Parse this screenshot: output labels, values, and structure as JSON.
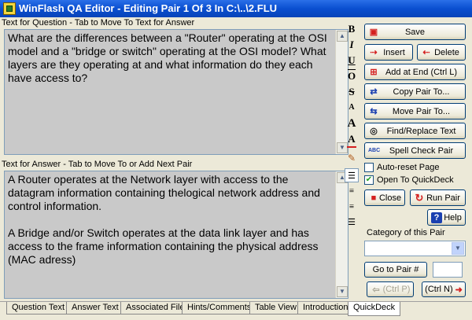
{
  "window": {
    "title": "WinFlash QA Editor - Editing Pair 1 Of 3 In C:\\..\\2.FLU"
  },
  "question": {
    "label": "Text for Question - Tab to Move To Text for Answer",
    "text": "What are the differences between a \"Router\" operating at the OSI model and a \"bridge or switch\" operating at the OSI model? What layers are they operating at and what information do they each have access to?"
  },
  "answer": {
    "label": "Text for Answer - Tab to Move To or Add Next Pair",
    "text": "A Router operates at the Network layer with access to the datagram information containing thelogical network address and control information.\n\nA Bridge and/or Switch operates at the data link layer and has access to the frame information containing the physical address (MAC adress)"
  },
  "format_toolbar": {
    "bold": "B",
    "italic": "I",
    "underline": "U",
    "overline": "O",
    "strike": "S",
    "font_size": "A",
    "font_size_big": "A",
    "font_color": "A"
  },
  "buttons": {
    "save": "Save",
    "insert": "Insert",
    "delete": "Delete",
    "add_at_end": "Add at End (Ctrl L)",
    "copy_pair": "Copy Pair To...",
    "move_pair": "Move Pair To...",
    "find_replace": "Find/Replace Text",
    "spell_check": "Spell Check Pair",
    "close": "Close",
    "run_pair": "Run Pair",
    "help": "Help",
    "go_to_pair": "Go to Pair #",
    "prev": "(Ctrl P)",
    "next": "(Ctrl N)"
  },
  "options": {
    "auto_reset": {
      "label": "Auto-reset Page",
      "checked": false
    },
    "open_quickdeck": {
      "label": "Open To QuickDeck",
      "checked": true
    }
  },
  "category": {
    "label": "Category of this Pair",
    "value": ""
  },
  "goto_value": "",
  "tabs": [
    {
      "label": "Question Text",
      "active": false
    },
    {
      "label": "Answer Text",
      "active": false
    },
    {
      "label": "Associated Files",
      "active": false
    },
    {
      "label": "Hints/Comments",
      "active": false
    },
    {
      "label": "Table View",
      "active": false
    },
    {
      "label": "Introduction",
      "active": false
    },
    {
      "label": "QuickDeck",
      "active": true
    }
  ],
  "colors": {
    "titlebar": "#0a4fd0",
    "textbox_bg": "#c9c9c9",
    "face": "#ece9d8",
    "accent_red": "#d42020"
  }
}
